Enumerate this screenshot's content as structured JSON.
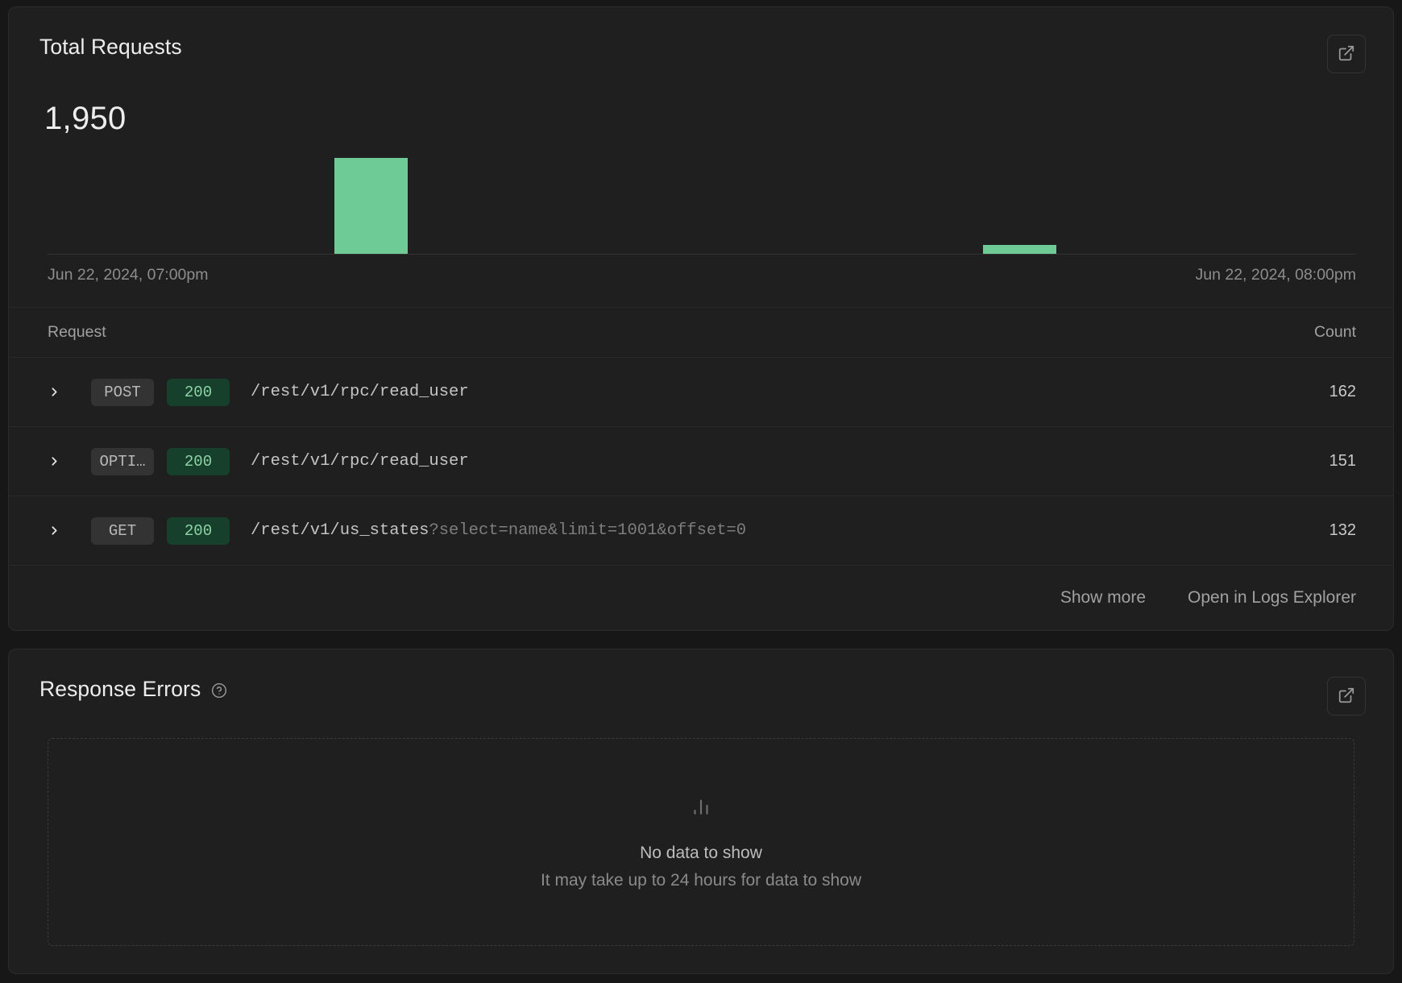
{
  "total_requests": {
    "title": "Total Requests",
    "value": "1,950",
    "open_icon": "external-link-icon",
    "axis_start": "Jun 22, 2024, 07:00pm",
    "axis_end": "Jun 22, 2024, 08:00pm",
    "table": {
      "columns": {
        "request": "Request",
        "count": "Count"
      },
      "rows": [
        {
          "expand_icon": "chevron-right-icon",
          "method": "POST",
          "status": "200",
          "path": "/rest/v1/rpc/read_user",
          "query": "",
          "count": "162"
        },
        {
          "expand_icon": "chevron-right-icon",
          "method": "OPTI…",
          "status": "200",
          "path": "/rest/v1/rpc/read_user",
          "query": "",
          "count": "151"
        },
        {
          "expand_icon": "chevron-right-icon",
          "method": "GET",
          "status": "200",
          "path": "/rest/v1/us_states",
          "query": "?select=name&limit=1001&offset=0",
          "count": "132"
        }
      ]
    },
    "footer": {
      "show_more": "Show more",
      "open_logs": "Open in Logs Explorer"
    }
  },
  "response_errors": {
    "title": "Response Errors",
    "help_icon": "help-circle-icon",
    "open_icon": "external-link-icon",
    "empty_icon": "bar-chart-icon",
    "empty_title": "No data to show",
    "empty_subtitle": "It may take up to 24 hours for data to show"
  },
  "chart_data": {
    "type": "bar",
    "title": "Total Requests",
    "categories": [
      "Jun 22, 2024, 07:00pm",
      "Jun 22, 2024, 08:00pm"
    ],
    "x": [
      {
        "label": "Jun 22, 2024, 07:00pm",
        "left_pct": 21.9,
        "width_pct": 5.6,
        "value": 1817,
        "height_pct": 100
      },
      {
        "label": "Jun 22, 2024, 08:00pm",
        "left_pct": 71.5,
        "width_pct": 5.6,
        "value": 133,
        "height_pct": 9.5
      }
    ],
    "values": [
      1817,
      133
    ],
    "total": 1950,
    "xlabel": "",
    "ylabel": "",
    "grid": false,
    "legend": "none",
    "bar_color": "#6ECB95"
  },
  "colors": {
    "accent_green": "#6ECB95",
    "status_badge_bg": "#16402c",
    "status_badge_fg": "#8fd4a8",
    "card_bg": "#1f1f1f",
    "page_bg": "#171717"
  }
}
